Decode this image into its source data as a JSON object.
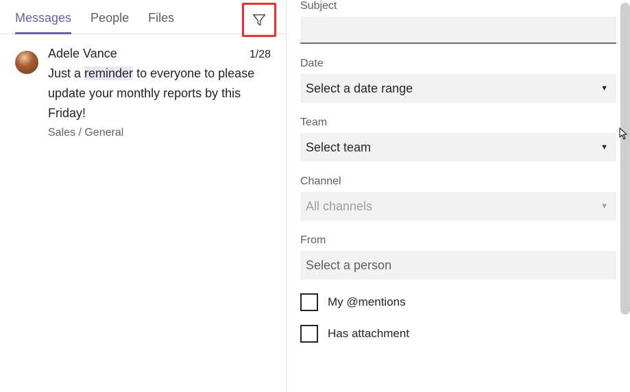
{
  "tabs": {
    "messages": "Messages",
    "people": "People",
    "files": "Files"
  },
  "message": {
    "sender": "Adele Vance",
    "date": "1/28",
    "text_prefix": "Just a ",
    "text_highlight": "reminder",
    "text_suffix": " to everyone to please update your monthly reports by this Friday!",
    "location": "Sales / General"
  },
  "filter": {
    "subject_label": "Subject",
    "subject_value": "",
    "date_label": "Date",
    "date_placeholder": "Select a date range",
    "team_label": "Team",
    "team_placeholder": "Select team",
    "channel_label": "Channel",
    "channel_placeholder": "All channels",
    "from_label": "From",
    "from_placeholder": "Select a person",
    "mentions_label": "My @mentions",
    "attachment_label": "Has attachment"
  }
}
